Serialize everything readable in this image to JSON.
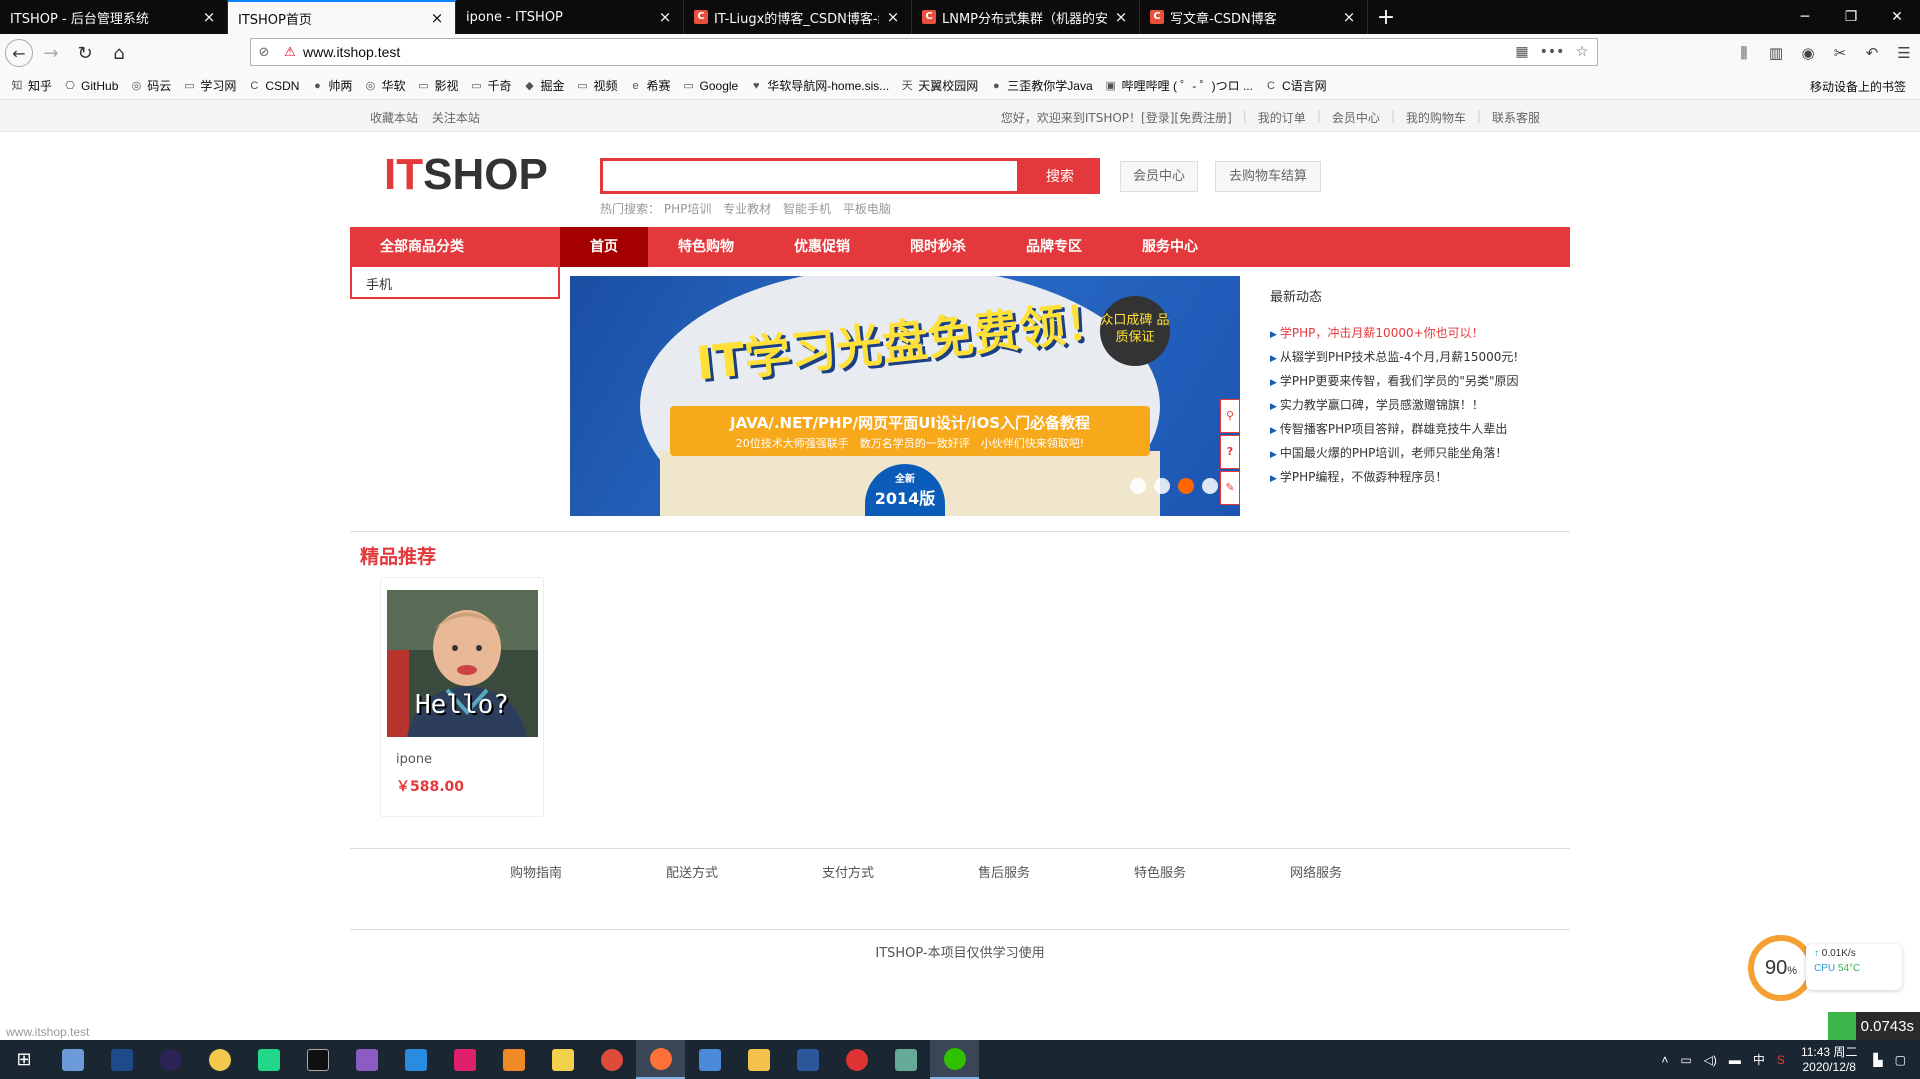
{
  "browser": {
    "tabs": [
      {
        "title": "ITSHOP - 后台管理系统",
        "fav": "",
        "active": false
      },
      {
        "title": "ITSHOP首页",
        "fav": "",
        "active": true
      },
      {
        "title": "ipone - ITSHOP",
        "fav": "",
        "active": false
      },
      {
        "title": "IT-Liugx的博客_CSDN博客-编...",
        "fav": "C",
        "active": false
      },
      {
        "title": "LNMP分布式集群（机器的安...",
        "fav": "C",
        "active": false
      },
      {
        "title": "写文章-CSDN博客",
        "fav": "C",
        "active": false
      }
    ],
    "url": "www.itshop.test",
    "bookmarks": [
      "知乎",
      "GitHub",
      "码云",
      "学习网",
      "CSDN",
      "帅两",
      "华软",
      "影视",
      "千奇",
      "掘金",
      "视频",
      "希赛",
      "Google",
      "华软导航网-home.sis...",
      "天翼校园网",
      "三歪教你学Java",
      "哔哩哔哩 ( ゜- ゜)つロ ...",
      "C语言网"
    ],
    "bookmarks_right": "移动设备上的书签",
    "status_url": "www.itshop.test"
  },
  "topbar": {
    "left": [
      "收藏本站",
      "关注本站"
    ],
    "welcome": "您好，欢迎来到ITSHOP！[登录][免费注册]",
    "links": [
      "我的订单",
      "会员中心",
      "我的购物车",
      "联系客服"
    ]
  },
  "header": {
    "logo_it": "IT",
    "logo_shop": "SHOP",
    "search_placeholder": "",
    "search_button": "搜索",
    "hot_label": "热门搜索：",
    "hot_terms": [
      "PHP培训",
      "专业教材",
      "智能手机",
      "平板电脑"
    ],
    "member_button": "会员中心",
    "cart_button": "去购物车结算"
  },
  "nav": {
    "all_categories": "全部商品分类",
    "items": [
      "首页",
      "特色购物",
      "优惠促销",
      "限时秒杀",
      "品牌专区",
      "服务中心"
    ],
    "active_index": 0,
    "category_item": "手机"
  },
  "banner": {
    "title": "IT学习光盘免费领！",
    "seal": "众口成碑 品质保证",
    "line1": "JAVA/.NET/PHP/网页平面UI设计/iOS入门必备教程",
    "line2": "20位技术大师强强联手　数万名学员的一致好评　小伙伴们快来领取吧!",
    "badge_top": "全新",
    "badge_bottom": "2014版",
    "active_dot": 2
  },
  "news": {
    "title": "最新动态",
    "items": [
      "学PHP，冲击月薪10000+你也可以！",
      "从辍学到PHP技术总监-4个月,月薪15000元!",
      "学PHP更要来传智，看我们学员的\"另类\"原因",
      "实力教学赢口碑，学员感激赠锦旗！！",
      "传智播客PHP项目答辩，群雄竞技牛人辈出",
      "中国最火爆的PHP培训，老师只能坐角落！",
      "学PHP编程，不做孬种程序员！"
    ]
  },
  "section": {
    "title": "精品推荐",
    "products": [
      {
        "name": "ipone",
        "price": "￥588.00",
        "image_text": "Hello?"
      }
    ]
  },
  "footer": {
    "links": [
      "购物指南",
      "配送方式",
      "支付方式",
      "售后服务",
      "特色服务",
      "网络服务"
    ],
    "copyright": "ITSHOP-本项目仅供学习使用"
  },
  "overlay": {
    "cpu_percent": "90",
    "net_speed": "0.01K/s",
    "cpu_label": "CPU",
    "cpu_temp": "54°C",
    "timer": "0.0743s"
  },
  "taskbar": {
    "time": "11:43 周二",
    "date": "2020/12/8",
    "ime": "中"
  },
  "colors": {
    "brand_red": "#e4393c",
    "nav_active": "#a40000",
    "tab_highlight": "#0a84ff"
  }
}
